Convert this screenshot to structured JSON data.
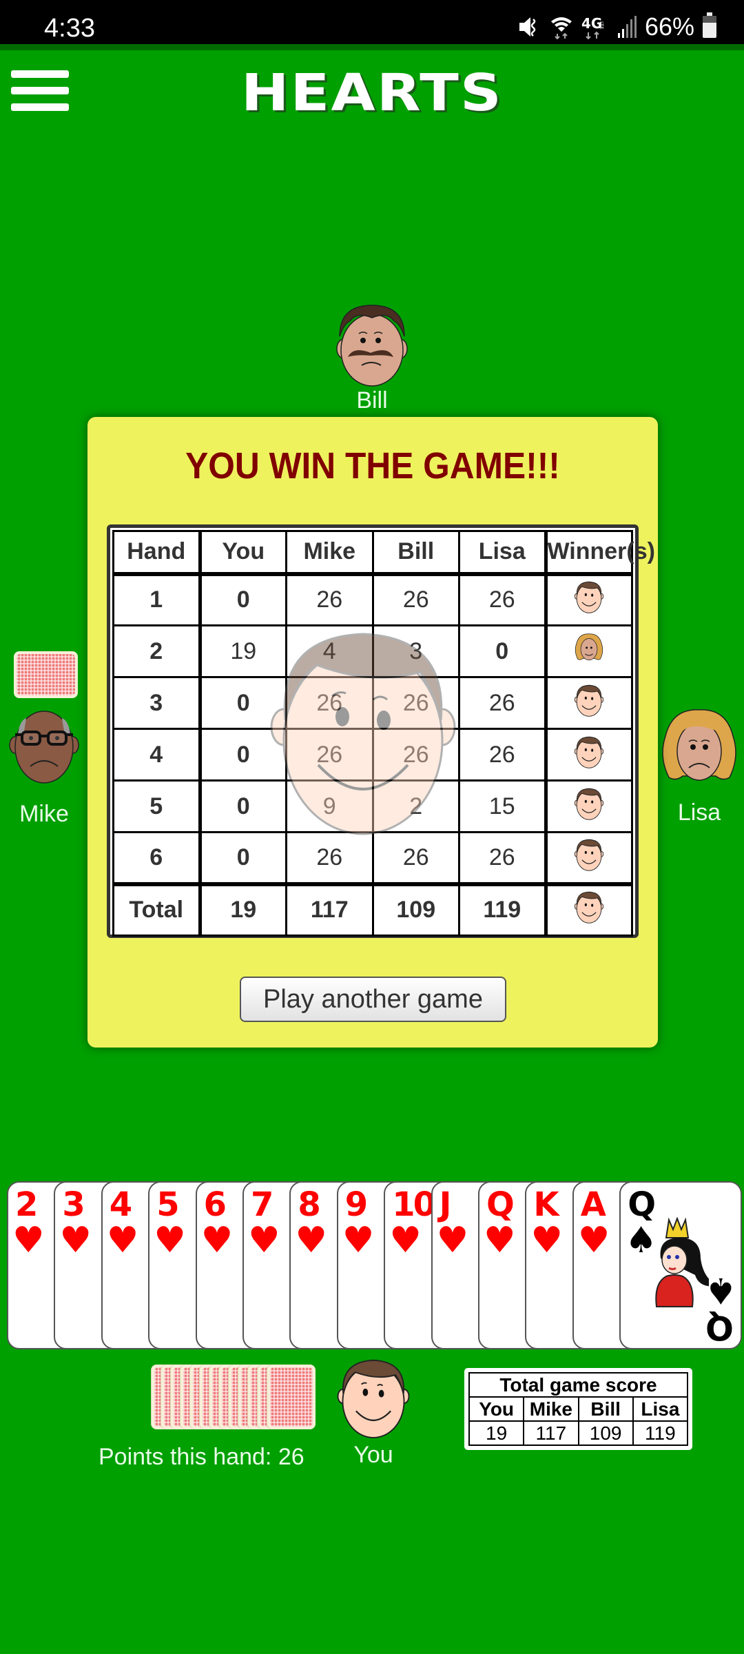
{
  "status_bar": {
    "time": "4:33",
    "icons": [
      "mute-icon",
      "wifi-icon",
      "4g-lte-icon",
      "signal-icon"
    ],
    "battery_percent": "66%"
  },
  "header": {
    "menu_icon": "hamburger-menu-icon",
    "title": "HEARTS"
  },
  "colors": {
    "table_felt": "#00a000",
    "dialog_bg": "#eef25d",
    "dialog_title": "#800000",
    "heart_red": "#ff0000"
  },
  "players": {
    "north": {
      "name": "Bill",
      "expression": "sad"
    },
    "west": {
      "name": "Mike",
      "expression": "sad"
    },
    "east": {
      "name": "Lisa",
      "expression": "sad"
    },
    "south": {
      "name": "You",
      "expression": "happy"
    }
  },
  "dialog": {
    "title": "YOU WIN THE GAME!!!",
    "columns": [
      "Hand",
      "You",
      "Mike",
      "Bill",
      "Lisa",
      "Winner(s)"
    ],
    "rows": [
      {
        "hand": "1",
        "scores": [
          "0",
          "26",
          "26",
          "26"
        ],
        "bold": [
          true,
          false,
          false,
          false
        ],
        "winner": "You"
      },
      {
        "hand": "2",
        "scores": [
          "19",
          "4",
          "3",
          "0"
        ],
        "bold": [
          false,
          false,
          false,
          true
        ],
        "winner": "Lisa"
      },
      {
        "hand": "3",
        "scores": [
          "0",
          "26",
          "26",
          "26"
        ],
        "bold": [
          true,
          false,
          false,
          false
        ],
        "winner": "You"
      },
      {
        "hand": "4",
        "scores": [
          "0",
          "26",
          "26",
          "26"
        ],
        "bold": [
          true,
          false,
          false,
          false
        ],
        "winner": "You"
      },
      {
        "hand": "5",
        "scores": [
          "0",
          "9",
          "2",
          "15"
        ],
        "bold": [
          true,
          false,
          false,
          false
        ],
        "winner": "You"
      },
      {
        "hand": "6",
        "scores": [
          "0",
          "26",
          "26",
          "26"
        ],
        "bold": [
          true,
          false,
          false,
          false
        ],
        "winner": "You"
      }
    ],
    "total": {
      "label": "Total",
      "scores": [
        "19",
        "117",
        "109",
        "119"
      ],
      "winner": "You"
    },
    "play_again_label": "Play another game"
  },
  "hand_cards": [
    {
      "rank": "2",
      "suit": "♥",
      "color": "red"
    },
    {
      "rank": "3",
      "suit": "♥",
      "color": "red"
    },
    {
      "rank": "4",
      "suit": "♥",
      "color": "red"
    },
    {
      "rank": "5",
      "suit": "♥",
      "color": "red"
    },
    {
      "rank": "6",
      "suit": "♥",
      "color": "red"
    },
    {
      "rank": "7",
      "suit": "♥",
      "color": "red"
    },
    {
      "rank": "8",
      "suit": "♥",
      "color": "red"
    },
    {
      "rank": "9",
      "suit": "♥",
      "color": "red"
    },
    {
      "rank": "10",
      "suit": "♥",
      "color": "red"
    },
    {
      "rank": "J",
      "suit": "♥",
      "color": "red"
    },
    {
      "rank": "Q",
      "suit": "♥",
      "color": "red"
    },
    {
      "rank": "K",
      "suit": "♥",
      "color": "red"
    },
    {
      "rank": "A",
      "suit": "♥",
      "color": "red"
    },
    {
      "rank": "Q",
      "suit": "♠",
      "color": "black"
    }
  ],
  "tricks_pile_count": 13,
  "points_this_hand_label": "Points this hand: 26",
  "total_game_score": {
    "title": "Total game score",
    "players": [
      "You",
      "Mike",
      "Bill",
      "Lisa"
    ],
    "scores": [
      "19",
      "117",
      "109",
      "119"
    ]
  }
}
